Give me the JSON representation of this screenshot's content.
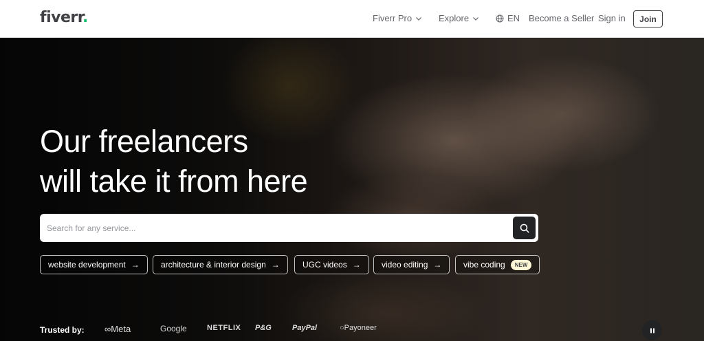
{
  "header": {
    "logo_text": "fiverr",
    "logo_dot": ".",
    "nav": {
      "fiverr_pro": "Fiverr Pro",
      "explore": "Explore",
      "language": "EN",
      "become_seller": "Become a Seller",
      "sign_in": "Sign in",
      "join": "Join"
    }
  },
  "hero": {
    "title_line1": "Our freelancers",
    "title_line2": "will take it from here",
    "search": {
      "placeholder": "Search for any service..."
    },
    "chips": [
      {
        "label": "website development"
      },
      {
        "label": "architecture & interior design"
      },
      {
        "label": "UGC videos"
      },
      {
        "label": "video editing"
      },
      {
        "label": "vibe coding",
        "badge": "NEW"
      }
    ],
    "trusted_label": "Trusted by:",
    "brands": [
      "Meta",
      "Google",
      "NETFLIX",
      "P&G",
      "PayPal",
      "Payoneer"
    ]
  },
  "colors": {
    "brand_green": "#1dbf73",
    "text_dark": "#404145"
  }
}
